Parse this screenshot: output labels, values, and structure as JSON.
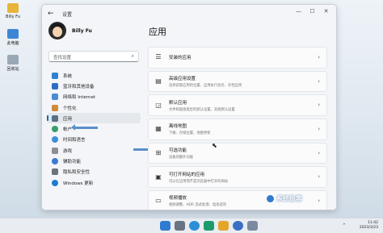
{
  "desktop": {
    "icons": [
      {
        "label": "Billy Fu",
        "color": "#e8b53a"
      },
      {
        "label": "此电脑",
        "color": "#3d86d6"
      },
      {
        "label": "回收站",
        "color": "#9aa8b5"
      }
    ]
  },
  "window": {
    "title": "设置",
    "back_icon": "←",
    "controls": {
      "minimize": "—",
      "maximize": "☐",
      "close": "✕"
    }
  },
  "profile": {
    "name": "Billy Fu"
  },
  "search": {
    "placeholder": "查找设置",
    "icon": "⌕"
  },
  "nav": {
    "items": [
      {
        "label": "系统",
        "color": "#2f80d1",
        "active": false
      },
      {
        "label": "蓝牙和其他设备",
        "color": "#2b6fc2",
        "active": false
      },
      {
        "label": "网络和 Internet",
        "color": "#4a8bd8",
        "active": false
      },
      {
        "label": "个性化",
        "color": "#d08a3a",
        "active": false
      },
      {
        "label": "应用",
        "color": "#5a6e86",
        "active": true
      },
      {
        "label": "帐户",
        "color": "#35a06a",
        "active": false
      },
      {
        "label": "时间和语言",
        "color": "#3d8fd9",
        "active": false
      },
      {
        "label": "游戏",
        "color": "#8a8f96",
        "active": false
      },
      {
        "label": "辅助功能",
        "color": "#3a7bd5",
        "active": false
      },
      {
        "label": "隐私和安全性",
        "color": "#6b7280",
        "active": false
      },
      {
        "label": "Windows 更新",
        "color": "#1f7ad1",
        "active": false
      }
    ]
  },
  "page": {
    "title": "应用"
  },
  "cards": [
    {
      "title": "安装的应用",
      "subtitle": "",
      "icon": "☰"
    },
    {
      "title": "高级应用设置",
      "subtitle": "选择获取应用的位置、应用执行别名、存档应用",
      "icon": "▤"
    },
    {
      "title": "默认应用",
      "subtitle": "文件和链接类型的默认设置，其他默认设置",
      "icon": "◲"
    },
    {
      "title": "离线地图",
      "subtitle": "下载、存储位置、地图更新",
      "icon": "▦"
    },
    {
      "title": "可选功能",
      "subtitle": "设备的额外功能",
      "icon": "⊞"
    },
    {
      "title": "可打开网站的应用",
      "subtitle": "可以在应用而不是浏览器中打开的网站",
      "icon": "▣"
    },
    {
      "title": "视频播放",
      "subtitle": "视频调整、HDR 流式处理、电池选项",
      "icon": "▭"
    }
  ],
  "watermark": {
    "text": "系统极客"
  },
  "taskbar": {
    "app_colors": [
      "#2f7bd0",
      "#6b7280",
      "#2b8fd8",
      "#1d9b6c",
      "#e3a52a",
      "#3a6fc4",
      "#7a8aa0"
    ],
    "tray": "^",
    "time": "11:42",
    "date": "2023/3/23"
  }
}
